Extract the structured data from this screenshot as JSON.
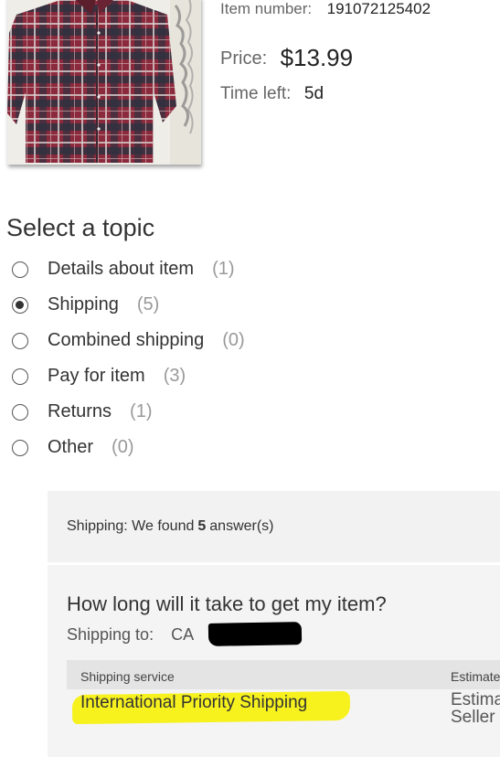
{
  "item": {
    "number_label": "Item number:",
    "number_value": "191072125402",
    "price_label": "Price:",
    "price_value": "$13.99",
    "time_left_label": "Time left:",
    "time_left_value": "5d"
  },
  "topics": {
    "title": "Select a topic",
    "items": [
      {
        "label": "Details about item",
        "count": "(1)",
        "selected": false
      },
      {
        "label": "Shipping",
        "count": "(5)",
        "selected": true
      },
      {
        "label": "Combined shipping",
        "count": "(0)",
        "selected": false
      },
      {
        "label": "Pay for item",
        "count": "(3)",
        "selected": false
      },
      {
        "label": "Returns",
        "count": "(1)",
        "selected": false
      },
      {
        "label": "Other",
        "count": "(0)",
        "selected": false
      }
    ]
  },
  "answers": {
    "found_prefix": "Shipping: We found",
    "found_count": "5",
    "found_suffix": "answer(s)",
    "question": "How long will it take to get my item?",
    "ship_to_label": "Shipping to:",
    "ship_to_value": "CA",
    "table": {
      "col_service": "Shipping service",
      "col_estimated": "Estimate",
      "service_name": "International Priority Shipping",
      "est_line1": "Estima",
      "est_line2": "Seller"
    }
  },
  "colors": {
    "highlight": "#f7f21e",
    "panel_bg": "#f2f2f2"
  }
}
